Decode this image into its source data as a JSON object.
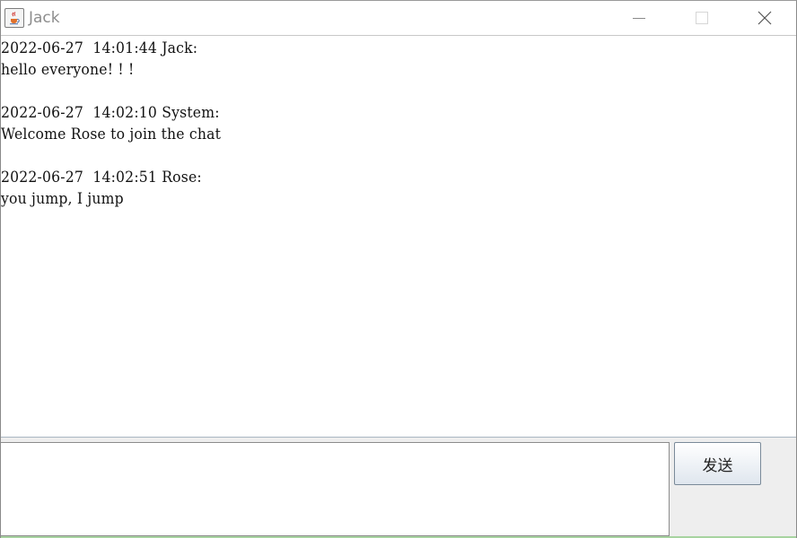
{
  "window": {
    "title": "Jack",
    "icon": "java-cup-icon",
    "controls": [
      "minimize-icon",
      "maximize-icon",
      "close-icon"
    ]
  },
  "chat": {
    "messages": [
      {
        "header": "2022-06-27  14:01:44 Jack:",
        "body": "hello everyone! ! !"
      },
      {
        "header": "2022-06-27  14:02:10 System:",
        "body": "Welcome Rose to join the chat"
      },
      {
        "header": "2022-06-27  14:02:51 Rose:",
        "body": "you jump, I jump"
      }
    ]
  },
  "input": {
    "value": "",
    "send_label": "发送"
  },
  "colors": {
    "title_text": "#8d8d8d",
    "panel_bg": "#eeeeee",
    "bottom_strip": "#a7d3a0"
  }
}
